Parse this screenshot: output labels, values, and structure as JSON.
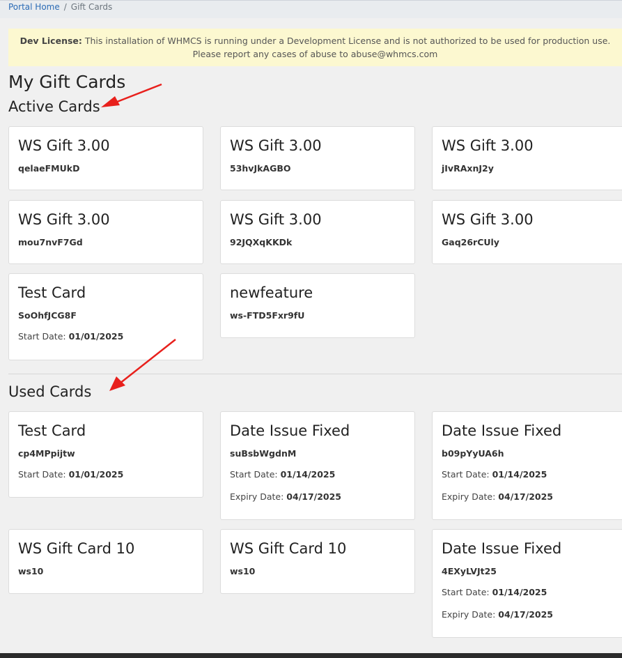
{
  "breadcrumb": {
    "home": "Portal Home",
    "separator": "/",
    "current": "Gift Cards"
  },
  "dev_banner": {
    "label": "Dev License:",
    "text": " This installation of WHMCS is running under a Development License and is not authorized to be used for production use.",
    "text2": "Please report any cases of abuse to abuse@whmcs.com"
  },
  "page_title": "My Gift Cards",
  "active_section": {
    "title": "Active Cards",
    "cards": [
      {
        "name": "WS Gift 3.00",
        "code": "qelaeFMUkD"
      },
      {
        "name": "WS Gift 3.00",
        "code": "53hvJkAGBO"
      },
      {
        "name": "WS Gift 3.00",
        "code": "jIvRAxnJ2y"
      },
      {
        "name": "WS Gift 3.00",
        "code": "mou7nvF7Gd"
      },
      {
        "name": "WS Gift 3.00",
        "code": "92JQXqKKDk"
      },
      {
        "name": "WS Gift 3.00",
        "code": "Gaq26rCUly"
      },
      {
        "name": "Test Card",
        "code": "SoOhfJCG8F",
        "start_label": "Start Date:",
        "start": "01/01/2025"
      },
      {
        "name": "newfeature",
        "code": "ws-FTD5Fxr9fU"
      }
    ]
  },
  "used_section": {
    "title": "Used Cards",
    "cards": [
      {
        "name": "Test Card",
        "code": "cp4MPpijtw",
        "start_label": "Start Date:",
        "start": "01/01/2025"
      },
      {
        "name": "Date Issue Fixed",
        "code": "suBsbWgdnM",
        "start_label": "Start Date:",
        "start": "01/14/2025",
        "expiry_label": "Expiry Date:",
        "expiry": "04/17/2025"
      },
      {
        "name": "Date Issue Fixed",
        "code": "b09pYyUA6h",
        "start_label": "Start Date:",
        "start": "01/14/2025",
        "expiry_label": "Expiry Date:",
        "expiry": "04/17/2025"
      },
      {
        "name": "WS Gift Card 10",
        "code": "ws10"
      },
      {
        "name": "WS Gift Card 10",
        "code": "ws10"
      },
      {
        "name": "Date Issue Fixed",
        "code": "4EXyLVJt25",
        "start_label": "Start Date:",
        "start": "01/14/2025",
        "expiry_label": "Expiry Date:",
        "expiry": "04/17/2025"
      }
    ]
  },
  "colors": {
    "arrow": "#e8201c",
    "link": "#2b6bb5",
    "banner_bg": "#fcf8d0"
  }
}
